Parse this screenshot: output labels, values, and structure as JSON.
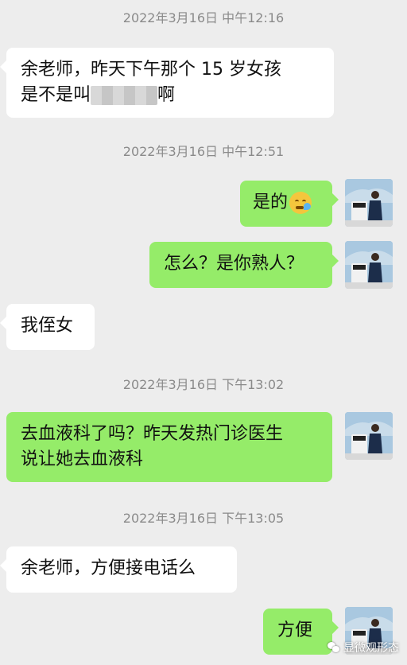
{
  "messages": [
    {
      "type": "timestamp",
      "text": "2022年3月16日 中午12:16"
    },
    {
      "type": "in",
      "line1": "余老师，昨天下午那个 15 岁女孩",
      "line2_before": "是不是叫",
      "line2_after": "啊"
    },
    {
      "type": "timestamp",
      "text": "2022年3月16日 中午12:51"
    },
    {
      "type": "out",
      "text": "是的",
      "emoji": "crying-laughing-emoji"
    },
    {
      "type": "out",
      "text": "怎么？是你熟人？"
    },
    {
      "type": "in",
      "text": "我侄女"
    },
    {
      "type": "timestamp",
      "text": "2022年3月16日 下午13:02"
    },
    {
      "type": "out",
      "line1": "去血液科了吗？昨天发热门诊医生",
      "line2": "说让她去血液科"
    },
    {
      "type": "timestamp",
      "text": "2022年3月16日 下午13:05"
    },
    {
      "type": "in",
      "text": "余老师，方便接电话么"
    },
    {
      "type": "out",
      "text": "方便"
    }
  ],
  "watermark": {
    "text": "显微观形态",
    "icon": "wechat-logo-icon"
  },
  "colors": {
    "background": "#ededed",
    "outgoing": "#95ec69",
    "incoming": "#ffffff",
    "timestamp": "#8a8a8a"
  }
}
